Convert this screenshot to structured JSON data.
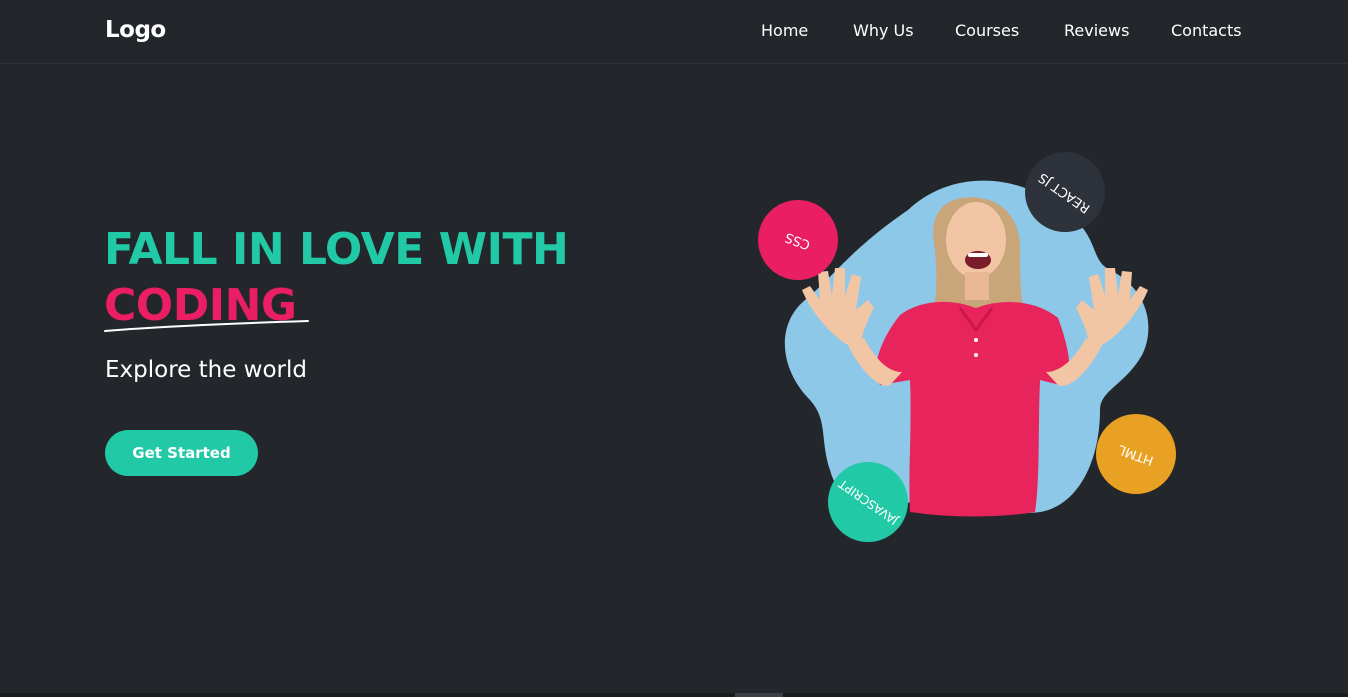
{
  "brand": {
    "logo_text": "Logo"
  },
  "nav": {
    "items": [
      {
        "label": "Home"
      },
      {
        "label": "Why Us"
      },
      {
        "label": "Courses"
      },
      {
        "label": "Reviews"
      },
      {
        "label": "Contacts"
      }
    ]
  },
  "hero": {
    "title_line1": "FALL IN LOVE WITH",
    "title_line2": "CODING",
    "subtitle": "Explore the world",
    "cta_label": "Get Started"
  },
  "badges": {
    "css": "CSS",
    "react": "REACT JS",
    "html": "HTML",
    "javascript": "JAVASCRIPT"
  },
  "colors": {
    "background": "#23272b",
    "accent_teal": "#22c9a6",
    "accent_pink": "#e91e63",
    "accent_orange": "#e9a124",
    "blob_blue": "#8ec8e8",
    "badge_dark": "#2e323a"
  }
}
